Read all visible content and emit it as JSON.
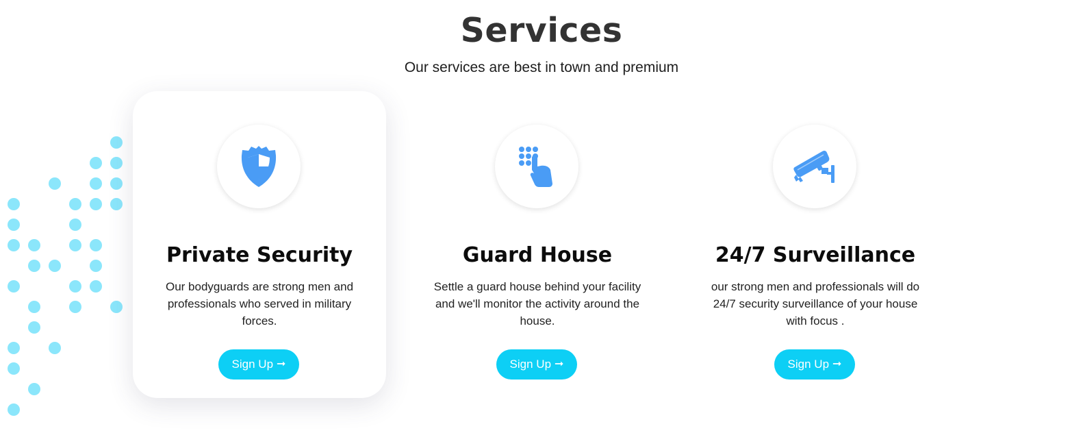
{
  "section": {
    "title": "Services",
    "subtitle": "Our services are best in town and premium"
  },
  "colors": {
    "accent": "#0dcff5",
    "icon_blue": "#4a9cf5",
    "dots": "#8be6fb",
    "heading": "#333333"
  },
  "cards": [
    {
      "icon": "shield-icon",
      "title": "Private Security",
      "description": "Our bodyguards are strong men and professionals who served in military forces.",
      "button_label": "Sign Up",
      "button_icon": "arrow-right-icon"
    },
    {
      "icon": "keypad-hand-icon",
      "title": "Guard House",
      "description": "Settle a guard house behind your facility and we'll monitor the activity around the house.",
      "button_label": "Sign Up",
      "button_icon": "arrow-right-icon"
    },
    {
      "icon": "cctv-camera-icon",
      "title": "24/7 Surveillance",
      "description": "our strong men and professionals will do 24/7 security surveillance of your house with focus .",
      "button_label": "Sign Up",
      "button_icon": "arrow-right-icon"
    }
  ]
}
